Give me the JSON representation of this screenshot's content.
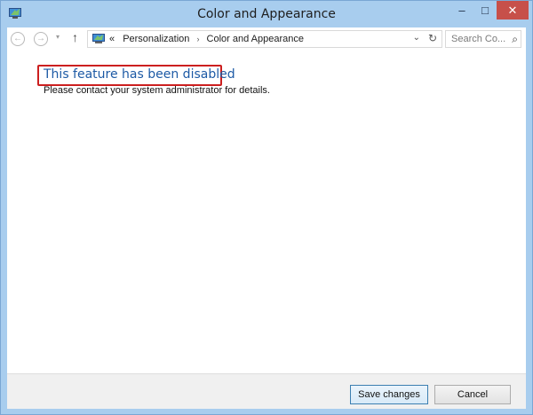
{
  "window": {
    "title": "Color and Appearance",
    "controls": {
      "minimize": "–",
      "maximize": "□",
      "close": "✕"
    }
  },
  "nav": {
    "back_icon": "back-arrow-icon",
    "forward_icon": "forward-arrow-icon",
    "up_icon": "up-arrow-icon",
    "back": "←",
    "forward": "→",
    "recent": "▾",
    "up": "↑"
  },
  "address": {
    "overflow": "«",
    "crumbs": [
      "Personalization",
      "Color and Appearance"
    ],
    "separator": "›",
    "dropdown": "⌄",
    "refresh": "↻"
  },
  "search": {
    "placeholder": "Search Co...",
    "icon": "⌕"
  },
  "message": {
    "heading": "This feature has been disabled",
    "detail": "Please contact your system administrator for details."
  },
  "footer": {
    "save_label": "Save changes",
    "cancel_label": "Cancel"
  },
  "colors": {
    "frame": "#a8cdee",
    "heading": "#1d5aa5",
    "highlight": "#cc1f1f",
    "close": "#c7504a"
  }
}
